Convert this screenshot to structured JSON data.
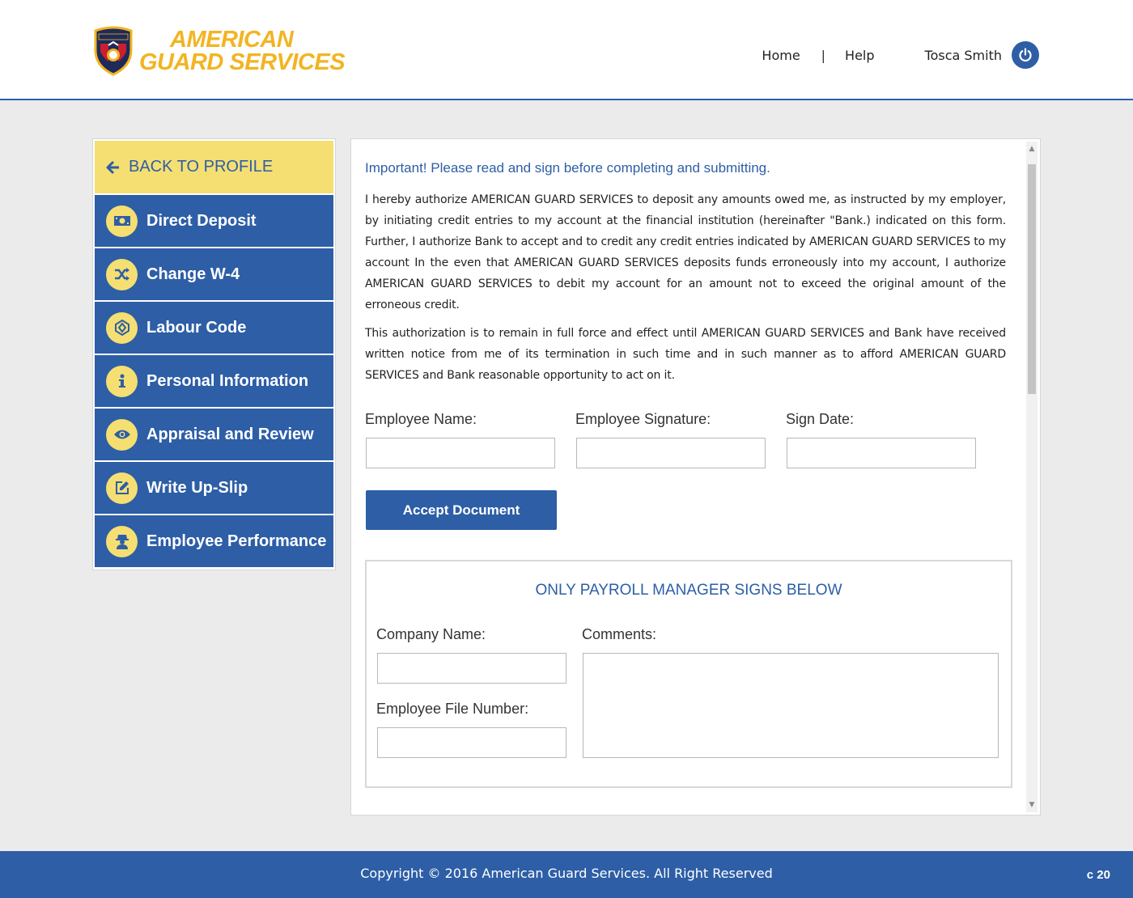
{
  "brand": {
    "line1": "AMERICAN",
    "line2": "GUARD SERVICES",
    "badge_text": "AMERICAN"
  },
  "nav": {
    "home": "Home",
    "separator": "|",
    "help": "Help",
    "user_name": "Tosca Smith",
    "power_icon": "power-icon"
  },
  "sidebar": {
    "back_label": "BACK TO PROFILE",
    "items": [
      {
        "label": "Direct Deposit",
        "icon": "money-icon"
      },
      {
        "label": "Change W-4",
        "icon": "shuffle-icon"
      },
      {
        "label": "Labour Code",
        "icon": "cube-icon"
      },
      {
        "label": "Personal Information",
        "icon": "info-icon"
      },
      {
        "label": "Appraisal and Review",
        "icon": "eye-icon"
      },
      {
        "label": "Write Up-Slip",
        "icon": "edit-icon"
      },
      {
        "label": "Employee Performance",
        "icon": "user-secret-icon"
      }
    ]
  },
  "document": {
    "important": "Important! Please read and sign before completing and submitting.",
    "paragraph1": "I hereby authorize AMERICAN GUARD SERVICES to deposit any amounts owed me, as instructed by my employer, by initiating credit entries to my account at the financial institution (hereinafter \"Bank.) indicated on this form. Further, I authorize Bank to accept and to credit any credit entries indicated by AMERICAN GUARD SERVICES to my account In the even that AMERICAN GUARD SERVICES deposits funds erroneously into my account, I authorize AMERICAN GUARD SERVICES to debit my account for an amount not to exceed the original amount of the erroneous credit.",
    "paragraph2": "This authorization is to remain in full force and effect until AMERICAN GUARD SERVICES and Bank have received written notice from me of its termination in such time and in such manner as to afford AMERICAN GUARD SERVICES and Bank reasonable opportunity to act on it.",
    "employee_name_label": "Employee Name:",
    "employee_signature_label": "Employee Signature:",
    "sign_date_label": "Sign Date:",
    "employee_name_value": "",
    "employee_signature_value": "",
    "sign_date_value": "",
    "accept_button": "Accept Document"
  },
  "payroll": {
    "title": "ONLY PAYROLL MANAGER SIGNS BELOW",
    "company_name_label": "Company Name:",
    "comments_label": "Comments:",
    "employee_file_label": "Employee File Number:",
    "company_name_value": "",
    "comments_value": "",
    "employee_file_value": ""
  },
  "footer": {
    "copyright": "Copyright © 2016 American Guard Services. All Right Reserved",
    "code": "c 20"
  },
  "colors": {
    "primary_blue": "#2d5ea6",
    "accent_yellow": "#f5df72",
    "brand_gold": "#f2b421"
  }
}
